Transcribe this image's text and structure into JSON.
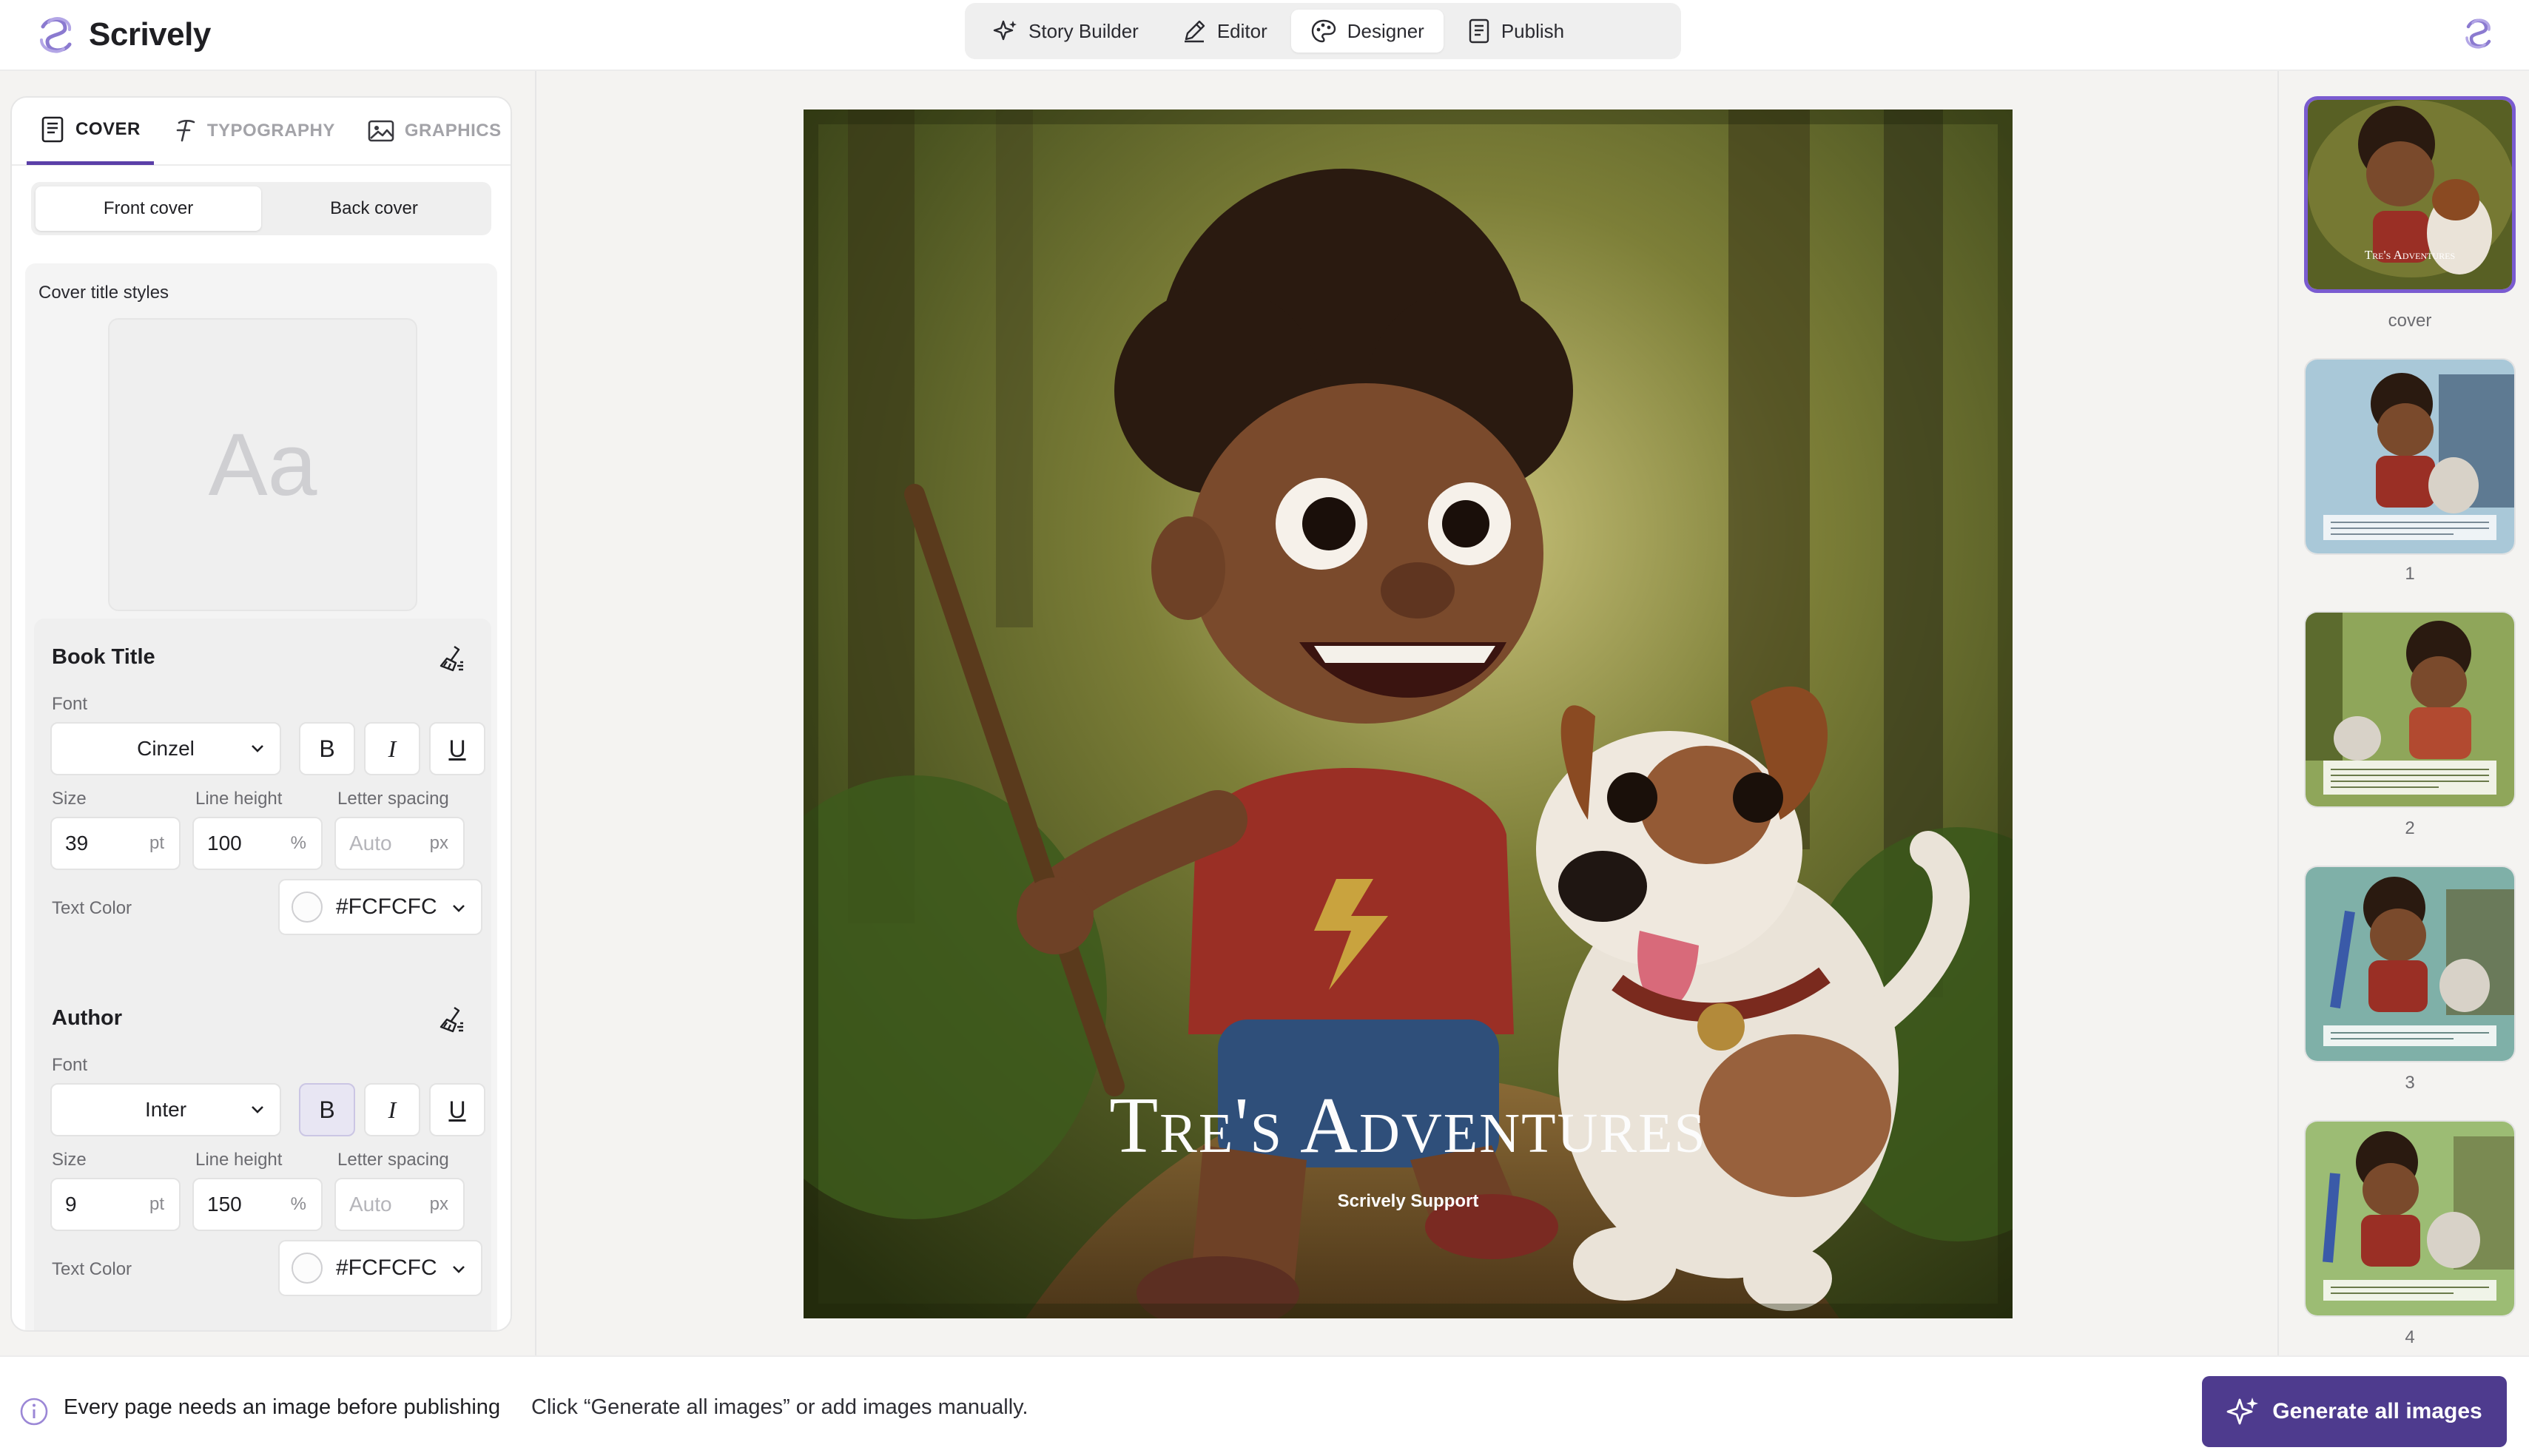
{
  "app": {
    "name": "Scrively"
  },
  "nav": [
    {
      "label": "Story Builder",
      "icon": "sparkle-icon"
    },
    {
      "label": "Editor",
      "icon": "pen-icon"
    },
    {
      "label": "Designer",
      "icon": "palette-icon",
      "active": true
    },
    {
      "label": "Publish",
      "icon": "document-icon"
    }
  ],
  "left_panel": {
    "tabs": [
      {
        "label": "COVER",
        "active": true
      },
      {
        "label": "TYPOGRAPHY"
      },
      {
        "label": "GRAPHICS"
      }
    ],
    "segment": {
      "front": "Front cover",
      "back": "Back cover",
      "selected": "Front cover"
    },
    "section_label": "Cover title styles",
    "preview_text": "Aa",
    "book_title": {
      "heading": "Book Title",
      "font_label": "Font",
      "font": "Cinzel",
      "bold_glyph": "B",
      "italic_glyph": "I",
      "underline_glyph": "U",
      "size_label": "Size",
      "size": "39",
      "size_unit": "pt",
      "line_height_label": "Line height",
      "line_height": "100",
      "line_height_unit": "%",
      "letter_spacing_label": "Letter spacing",
      "letter_spacing_placeholder": "Auto",
      "letter_spacing_unit": "px",
      "text_color_label": "Text Color",
      "text_color": "#FCFCFC"
    },
    "author": {
      "heading": "Author",
      "font_label": "Font",
      "font": "Inter",
      "bold_glyph": "B",
      "italic_glyph": "I",
      "underline_glyph": "U",
      "bold_active": true,
      "size_label": "Size",
      "size": "9",
      "size_unit": "pt",
      "line_height_label": "Line height",
      "line_height": "150",
      "line_height_unit": "%",
      "letter_spacing_label": "Letter spacing",
      "letter_spacing_placeholder": "Auto",
      "letter_spacing_unit": "px",
      "text_color_label": "Text Color",
      "text_color": "#FCFCFC"
    }
  },
  "cover": {
    "title": "Tre's Adventures",
    "author": "Scrively Support"
  },
  "pages": [
    {
      "label": "cover",
      "selected": true
    },
    {
      "label": "1"
    },
    {
      "label": "2"
    },
    {
      "label": "3"
    },
    {
      "label": "4"
    }
  ],
  "thumb_cover_title": "Tre's Adventures",
  "bottom": {
    "message": "Every page needs an image before publishing",
    "hint": "Click “Generate all images” or add images manually.",
    "button": "Generate all images"
  },
  "colors": {
    "accent": "#4E3B8E",
    "selected_border": "#7A5BD0",
    "text_color": "#FCFCFC"
  }
}
